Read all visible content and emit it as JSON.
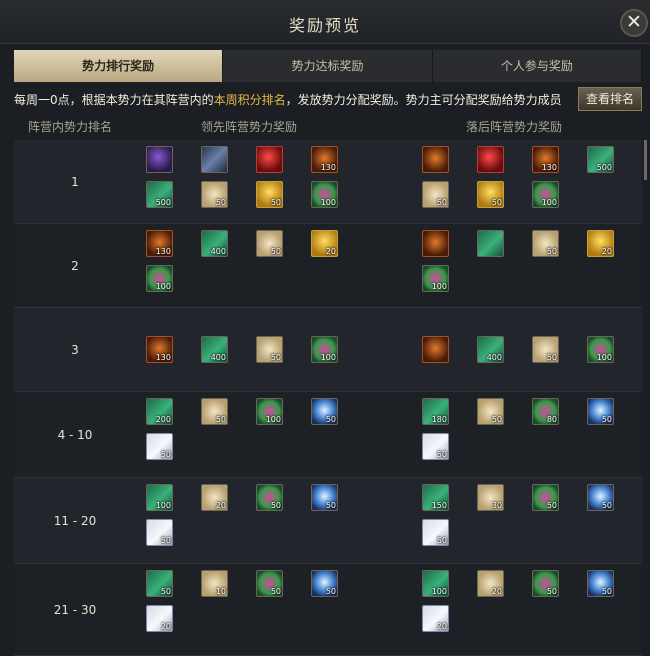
{
  "window": {
    "title": "奖励预览",
    "close": "✕"
  },
  "tabs": [
    {
      "label": "势力排行奖励",
      "active": true
    },
    {
      "label": "势力达标奖励",
      "active": false
    },
    {
      "label": "个人参与奖励",
      "active": false
    }
  ],
  "notice": {
    "p1": "每周一0点，根据本势力在其阵营内的",
    "p2": "本周积分排名",
    "p3": "，发放势力分配奖励。势力主可分配奖励给势力成员",
    "button": "查看排名"
  },
  "columns": {
    "rank": "阵营内势力排名",
    "leading": "领先阵营势力奖励",
    "trailing": "落后阵营势力奖励"
  },
  "rows": [
    {
      "rank": "1",
      "leading": [
        [
          "purple",
          ""
        ],
        [
          "sword",
          ""
        ],
        [
          "red",
          ""
        ],
        [
          "orange",
          "130"
        ],
        [
          "book",
          "500"
        ],
        [
          "scroll",
          "50"
        ],
        [
          "gold",
          "50"
        ],
        [
          "gem",
          "100"
        ]
      ],
      "trailing": [
        [
          "orange",
          ""
        ],
        [
          "red",
          ""
        ],
        [
          "orange",
          "130"
        ],
        [
          "book",
          "500"
        ],
        [
          "scroll",
          "50"
        ],
        [
          "gold",
          "50"
        ],
        [
          "gem",
          "100"
        ]
      ]
    },
    {
      "rank": "2",
      "leading": [
        [
          "orange",
          "130"
        ],
        [
          "book",
          "400"
        ],
        [
          "scroll",
          "50"
        ],
        [
          "gold",
          "20"
        ],
        [
          "gem",
          "100"
        ]
      ],
      "trailing": [
        [
          "orange",
          ""
        ],
        [
          "book",
          ""
        ],
        [
          "scroll",
          "50"
        ],
        [
          "gold",
          "20"
        ],
        [
          "gem",
          "100"
        ]
      ]
    },
    {
      "rank": "3",
      "leading": [
        [
          "orange",
          "130"
        ],
        [
          "book",
          "400"
        ],
        [
          "scroll",
          "50"
        ],
        [
          "gem",
          "100"
        ]
      ],
      "trailing": [
        [
          "orange",
          ""
        ],
        [
          "book",
          "400"
        ],
        [
          "scroll",
          "50"
        ],
        [
          "gem",
          "100"
        ]
      ]
    },
    {
      "rank": "4 - 10",
      "leading": [
        [
          "book",
          "200"
        ],
        [
          "scroll",
          "50"
        ],
        [
          "gem",
          "100"
        ],
        [
          "orb",
          "50"
        ],
        [
          "paper",
          "50"
        ]
      ],
      "trailing": [
        [
          "book",
          "180"
        ],
        [
          "scroll",
          "50"
        ],
        [
          "gem",
          "80"
        ],
        [
          "orb",
          "50"
        ],
        [
          "paper",
          "50"
        ]
      ]
    },
    {
      "rank": "11 - 20",
      "leading": [
        [
          "book",
          "100"
        ],
        [
          "scroll",
          "20"
        ],
        [
          "gem",
          "50"
        ],
        [
          "orb",
          "50"
        ],
        [
          "paper",
          "50"
        ]
      ],
      "trailing": [
        [
          "book",
          "150"
        ],
        [
          "scroll",
          "30"
        ],
        [
          "gem",
          "50"
        ],
        [
          "orb",
          "50"
        ],
        [
          "paper",
          "50"
        ]
      ]
    },
    {
      "rank": "21 - 30",
      "leading": [
        [
          "book",
          "50"
        ],
        [
          "scroll",
          "10"
        ],
        [
          "gem",
          "50"
        ],
        [
          "orb",
          "50"
        ],
        [
          "paper",
          "20"
        ]
      ],
      "trailing": [
        [
          "book",
          "100"
        ],
        [
          "scroll",
          "20"
        ],
        [
          "gem",
          "50"
        ],
        [
          "orb",
          "50"
        ],
        [
          "paper",
          "20"
        ]
      ]
    }
  ]
}
